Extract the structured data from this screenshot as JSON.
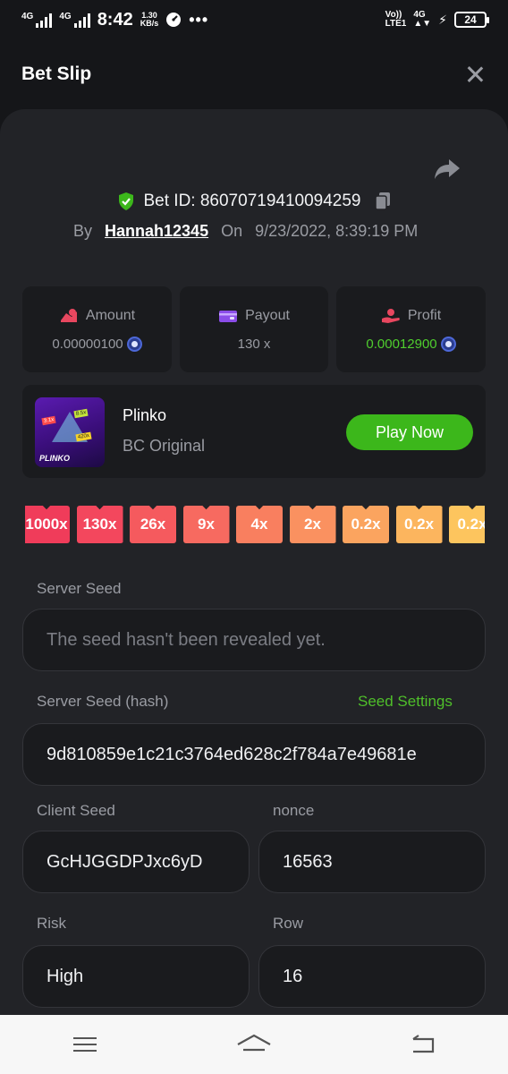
{
  "status_bar": {
    "signal1": "4G",
    "signal2": "4G",
    "time": "8:42",
    "speed_value": "1.30",
    "speed_unit": "KB/s",
    "more": "•••",
    "volte_top": "Vo))",
    "volte_bottom": "LTE1",
    "net": "4G",
    "battery": "24"
  },
  "header": {
    "title": "Bet Slip"
  },
  "bet": {
    "id_label": "Bet ID: 86070719410094259",
    "by_label": "By",
    "user": "Hannah12345",
    "on_label": "On",
    "datetime": "9/23/2022, 8:39:19 PM"
  },
  "stats": {
    "amount": {
      "label": "Amount",
      "value_main": "0.00000100",
      "value_tail": ""
    },
    "payout": {
      "label": "Payout",
      "value": "130 x"
    },
    "profit": {
      "label": "Profit",
      "value_main": "0.00012900"
    }
  },
  "game": {
    "name": "Plinko",
    "provider": "BC Original",
    "thumb_logo": "PLINKO",
    "thumb_badges": [
      "3.1x",
      "8.5x",
      "420x"
    ],
    "play_label": "Play Now"
  },
  "multipliers": [
    "1000x",
    "130x",
    "26x",
    "9x",
    "4x",
    "2x",
    "0.2x",
    "0.2x",
    "0.2x"
  ],
  "multiplier_colors": [
    "#f03c5a",
    "#f3475d",
    "#f55a5e",
    "#f76a60",
    "#f97f5f",
    "#fa9160",
    "#fba45f",
    "#fcb55e",
    "#fdc55e"
  ],
  "fields": {
    "server_seed": {
      "label": "Server Seed",
      "value": "The seed hasn't been revealed yet."
    },
    "server_seed_hash": {
      "label": "Server Seed (hash)",
      "link": "Seed Settings",
      "value": "9d810859e1c21c3764ed628c2f784a7e49681e"
    },
    "client_seed": {
      "label": "Client Seed",
      "value": "GcHJGGDPJxc6yD"
    },
    "nonce": {
      "label": "nonce",
      "value": "16563"
    },
    "risk": {
      "label": "Risk",
      "value": "High"
    },
    "row": {
      "label": "Row",
      "value": "16"
    }
  },
  "colors": {
    "accent_green": "#3cb71b",
    "profit_green": "#4fce2e",
    "panel": "#222327",
    "card": "#1a1b1e"
  }
}
